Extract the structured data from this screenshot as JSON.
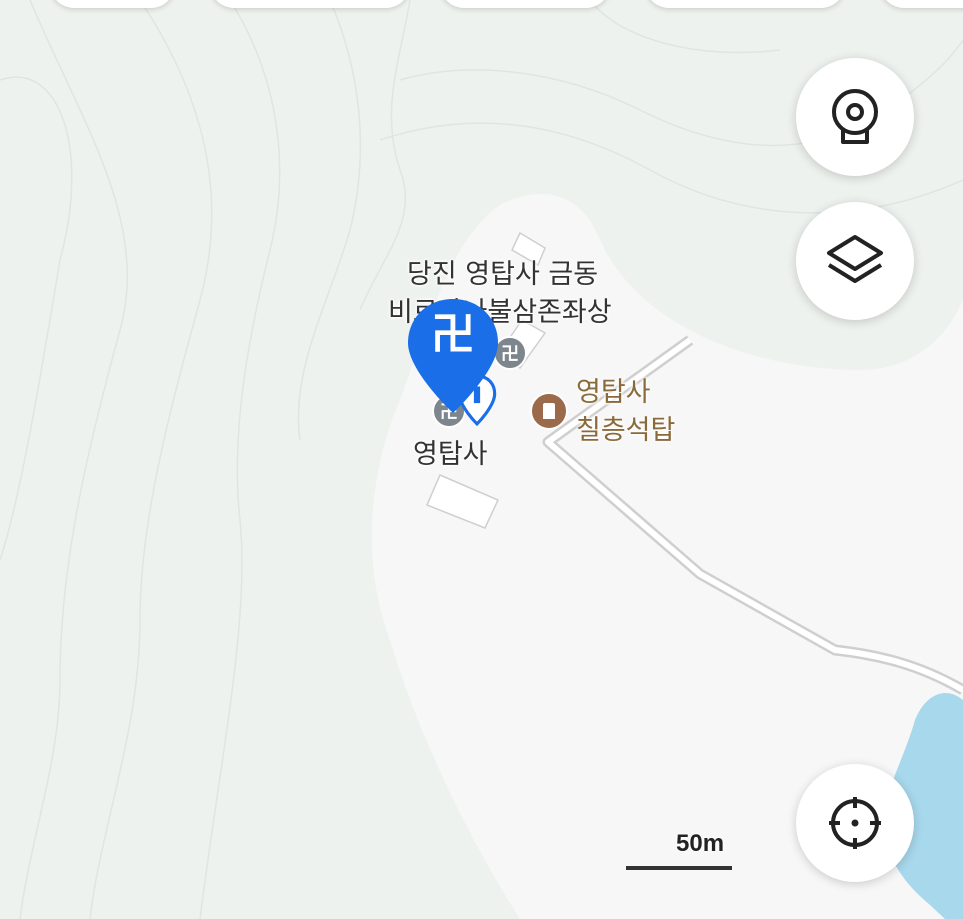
{
  "top_chips": [
    "",
    "",
    "",
    "",
    ""
  ],
  "controls": {
    "cctv": {
      "icon": "cctv-icon"
    },
    "layers": {
      "icon": "layers-icon"
    },
    "locate": {
      "icon": "crosshair-icon"
    }
  },
  "markers": {
    "selected": {
      "glyph": "卍",
      "icon": "temple-pin-icon",
      "color": "#1a6ee8"
    },
    "small_temple_glyph": "卍"
  },
  "labels": {
    "statue_line1": "당진 영탑사 금동",
    "statue_line2": "비로자나불삼존좌상",
    "pagoda_line1": "영탑사",
    "pagoda_line2": "칠층석탑",
    "temple": "영탑사"
  },
  "scale": {
    "label": "50m"
  },
  "colors": {
    "land": "#eef2ee",
    "cleared": "#f7f7f7",
    "water": "#a8d8ec",
    "accent": "#1a6ee8",
    "heritage": "#9a6a4a"
  }
}
